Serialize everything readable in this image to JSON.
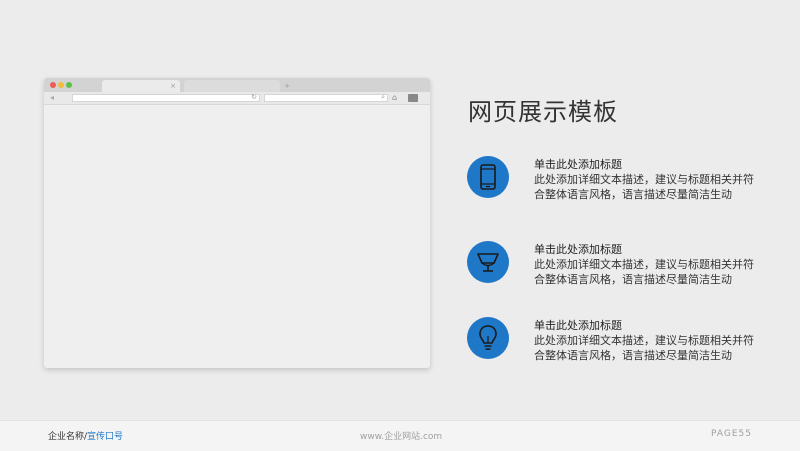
{
  "browser": {
    "tab_close": "×",
    "tab_plus": "+",
    "nav_back": "◂",
    "reload_glyph": "↻",
    "search_glyph": "⌕",
    "home_glyph": "⌂"
  },
  "slide": {
    "title": "网页展示模板",
    "features": [
      {
        "icon": "phone-icon",
        "title": "单击此处添加标题",
        "desc": "此处添加详细文本描述，建议与标题相关并符合整体语言风格，语言描述尽量简洁生动"
      },
      {
        "icon": "trophy-icon",
        "title": "单击此处添加标题",
        "desc": "此处添加详细文本描述，建议与标题相关并符合整体语言风格，语言描述尽量简洁生动"
      },
      {
        "icon": "lightbulb-icon",
        "title": "单击此处添加标题",
        "desc": "此处添加详细文本描述，建议与标题相关并符合整体语言风格，语言描述尽量简洁生动"
      }
    ]
  },
  "footer": {
    "company": "企业名称/",
    "slogan": "宣传口号",
    "website": "www.企业网站.com",
    "page": "PAGE55"
  },
  "colors": {
    "accent": "#1f77c8",
    "background": "#ececec"
  }
}
